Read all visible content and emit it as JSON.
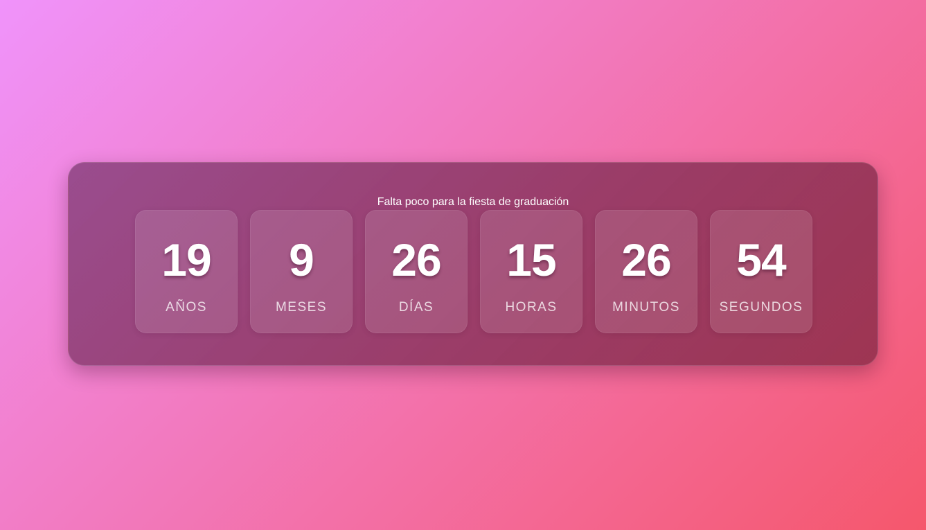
{
  "countdown": {
    "title": "Falta poco para la fiesta de graduación",
    "units": [
      {
        "value": "19",
        "label": "AÑOS"
      },
      {
        "value": "9",
        "label": "MESES"
      },
      {
        "value": "26",
        "label": "DÍAS"
      },
      {
        "value": "15",
        "label": "HORAS"
      },
      {
        "value": "26",
        "label": "MINUTOS"
      },
      {
        "value": "54",
        "label": "SEGUNDOS"
      }
    ]
  },
  "colors": {
    "background_start": "#f093fb",
    "background_end": "#f5576c",
    "text": "#ffffff"
  }
}
